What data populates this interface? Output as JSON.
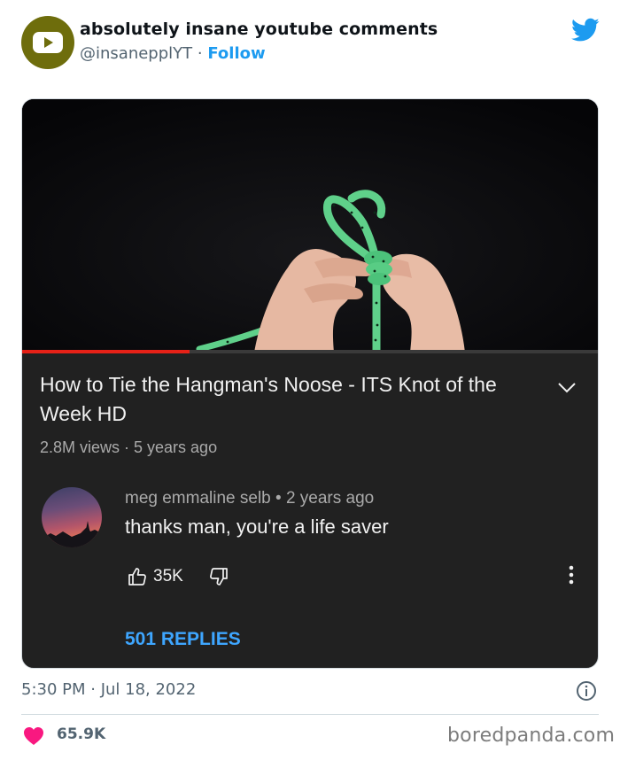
{
  "account": {
    "name": "absolutely insane youtube comments",
    "handle": "@insanepplYT",
    "separator": "·",
    "follow_label": "Follow"
  },
  "video": {
    "title": "How to Tie the Hangman's Noose - ITS Knot of the Week HD",
    "meta": "2.8M views · 5 years ago",
    "progress_fraction": 0.29
  },
  "comment": {
    "author_line": "meg emmaline selb • 2 years ago",
    "text": "thanks man, you're a life saver",
    "like_count": "35K",
    "replies_label": "501 REPLIES"
  },
  "tweet": {
    "timestamp": "5:30 PM · Jul 18, 2022",
    "likes": "65.9K"
  },
  "watermark": "boredpanda.com",
  "icons": {
    "avatar": "youtube-logo-icon",
    "brand": "twitter-bird-icon",
    "expand": "chevron-down-icon",
    "like": "thumbs-up-icon",
    "dislike": "thumbs-down-icon",
    "more": "vertical-dots-icon",
    "info": "info-icon",
    "heart": "heart-icon"
  },
  "colors": {
    "avatar_bg": "#6e6d0c",
    "follow": "#1d9bf0",
    "twitter": "#1d9bf0",
    "progress": "#e62117",
    "replies": "#3ea6ff",
    "heart": "#f91880",
    "card_bg": "#212121"
  }
}
